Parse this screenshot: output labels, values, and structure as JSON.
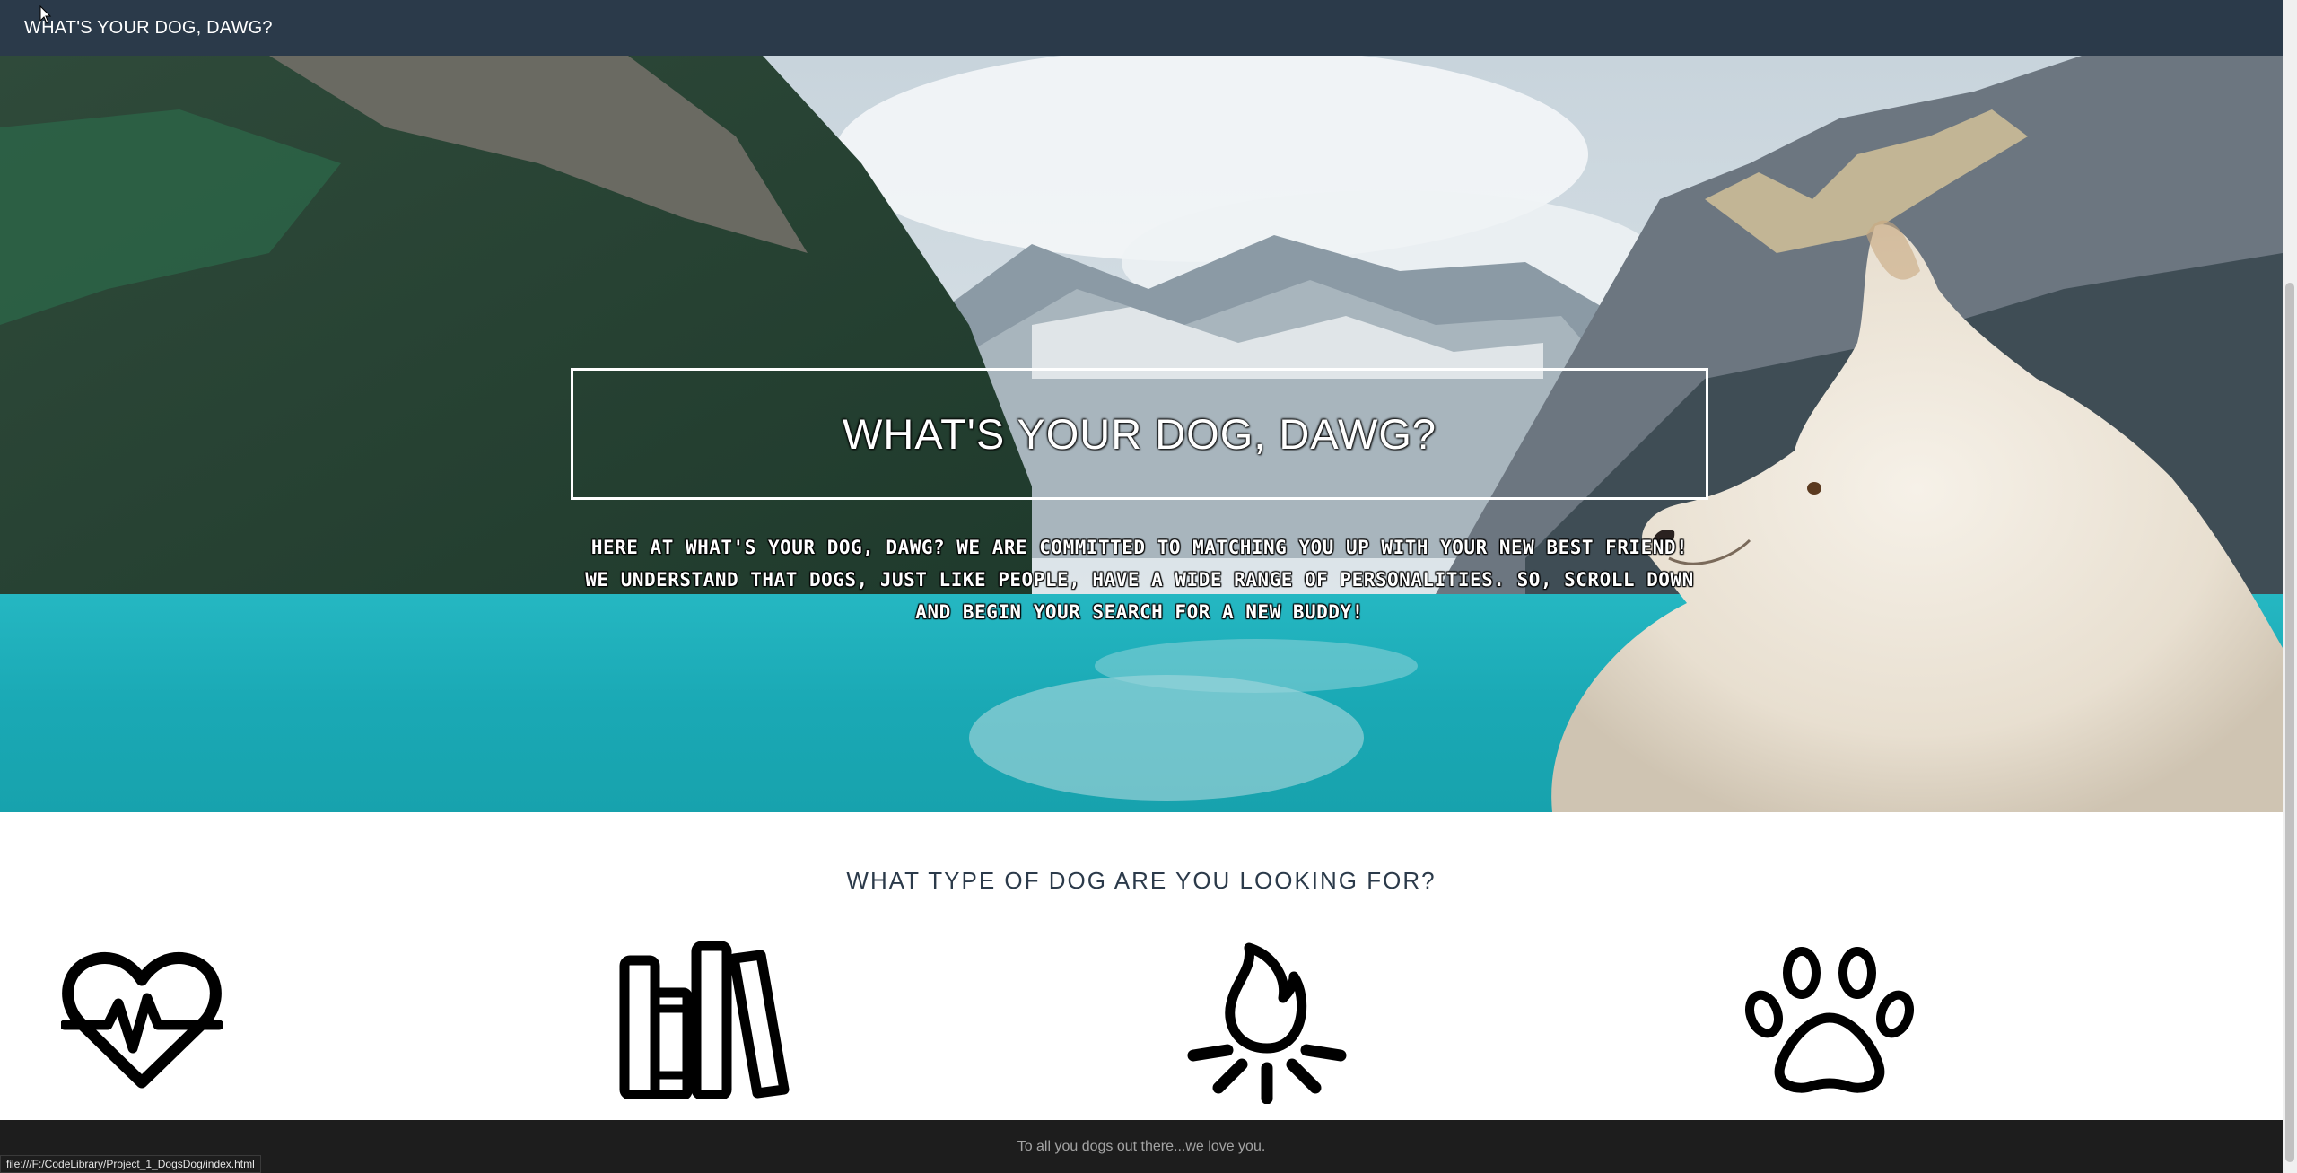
{
  "navbar": {
    "brand": "WHAT'S YOUR DOG, DAWG?"
  },
  "hero": {
    "title": "WHAT'S YOUR DOG, DAWG?",
    "intro": "Here at What's Your Dog, Dawg? we are committed to matching you up with your new best friend! We understand that dogs, just like people, have a wide range of personalities. So, scroll down and begin your search for a new buddy!"
  },
  "section": {
    "heading": "WHAT TYPE OF DOG ARE YOU LOOKING FOR?",
    "icons": [
      "heartbeat-icon",
      "books-icon",
      "campfire-icon",
      "paw-icon"
    ]
  },
  "footer": {
    "text": "To all you dogs out there...we love you."
  },
  "status_bar": {
    "url": "file:///F:/CodeLibrary/Project_1_DogsDog/index.html"
  },
  "colors": {
    "navbar": "#2b3a4a",
    "footer": "#1d1d1d",
    "heading": "#2b3a4a",
    "lake": "#1fb5c0"
  }
}
